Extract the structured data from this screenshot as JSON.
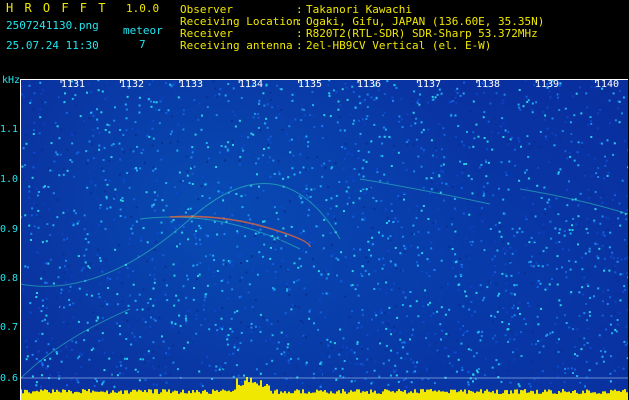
{
  "header": {
    "app_title": "H R O F F T",
    "version": "1.0.0",
    "filename": "2507241130.png",
    "datetime": "25.07.24 11:30",
    "event_label": "meteor",
    "event_count": "7"
  },
  "info": [
    {
      "label": "Observer",
      "sep": ":",
      "value": "Takanori Kawachi"
    },
    {
      "label": "Receiving Location",
      "sep": ":",
      "value": "Ogaki, Gifu, JAPAN (136.60E, 35.35N)"
    },
    {
      "label": "Receiver",
      "sep": ":",
      "value": "R820T2(RTL-SDR) SDR-Sharp 53.372MHz"
    },
    {
      "label": "Receiving antenna",
      "sep": ":",
      "value": "2el-HB9CV Vertical (el. E-W)"
    }
  ],
  "y_axis": {
    "unit": "kHz",
    "ticks": [
      "1.1",
      "1.0",
      "0.9",
      "0.8",
      "0.7",
      "0.6"
    ]
  },
  "x_axis": {
    "ticks": [
      "1131",
      "1132",
      "1133",
      "1134",
      "1135",
      "1136",
      "1137",
      "1138",
      "1139",
      "1140"
    ]
  },
  "colors": {
    "label": "#22e6f0",
    "accent": "#f0e800",
    "background": "#0a2a9a",
    "signal_floor": "#f0e800"
  }
}
